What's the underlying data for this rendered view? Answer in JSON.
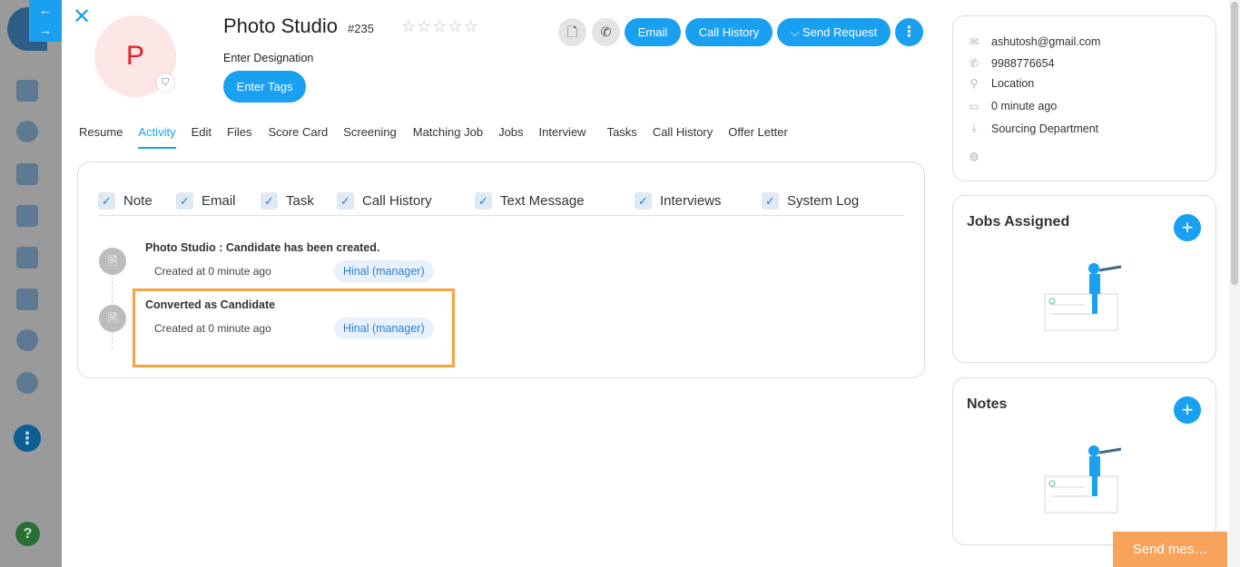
{
  "nav": {
    "back": "←",
    "forward": "→"
  },
  "candidate": {
    "initial": "P",
    "name": "Photo Studio",
    "id": "#235",
    "stars": "☆☆☆☆☆",
    "designation": "Enter Designation",
    "tags_label": "Enter Tags"
  },
  "actions": {
    "email": "Email",
    "call_history": "Call History",
    "send_request": "⌵ Send Request",
    "more": "⋮"
  },
  "tabs": [
    "Resume",
    "Activity",
    "Edit",
    "Files",
    "Score Card",
    "Screening",
    "Matching Job",
    "Jobs",
    "Interview",
    "Tasks",
    "Call History",
    "Offer Letter"
  ],
  "filters": [
    "Note",
    "Email",
    "Task",
    "Call History",
    "Text Message",
    "Interviews",
    "System Log"
  ],
  "events": [
    {
      "title": "Photo Studio : Candidate has been created.",
      "meta": "Created at 0 minute ago",
      "by": "Hinal (manager)"
    },
    {
      "title": "Converted as Candidate",
      "meta": "Created at 0 minute ago",
      "by": "Hinal (manager)"
    }
  ],
  "info": {
    "email": "ashutosh@gmail.com",
    "phone": "9988776654",
    "location": "Location",
    "time": "0 minute ago",
    "department": "Sourcing Department"
  },
  "jobs_assigned": {
    "title": "Jobs Assigned",
    "add": "+"
  },
  "notes": {
    "title": "Notes",
    "add": "+"
  },
  "send_message": "Send mes…",
  "colors": {
    "primary": "#1aa0f0",
    "highlight": "#f4a340",
    "avatar_bg": "#fde6e6",
    "avatar_text": "#e31e24"
  }
}
